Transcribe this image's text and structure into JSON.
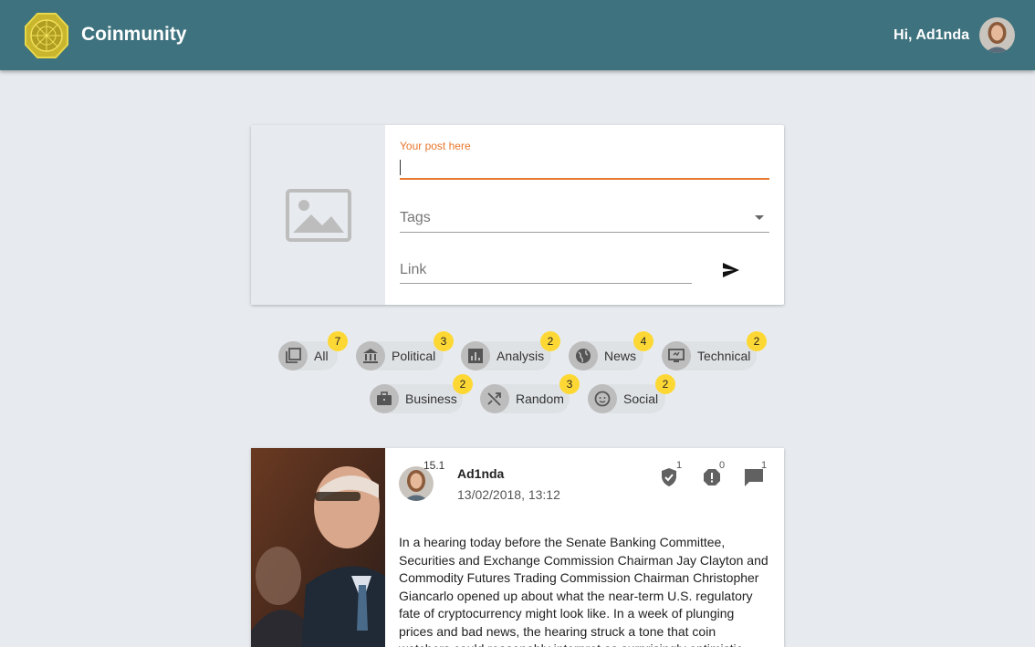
{
  "app": {
    "name": "Coinmunity",
    "logo_icon": "coin-logo-icon",
    "accent": "#3e727e"
  },
  "header": {
    "greeting": "Hi, Ad1nda",
    "avatar_icon": "user-avatar"
  },
  "composer": {
    "post_label": "Your post here",
    "post_value": "",
    "tags_label": "Tags",
    "link_placeholder": "Link",
    "image_icon": "image-placeholder-icon",
    "send_icon": "send-icon",
    "focus_color": "#e8762c"
  },
  "filters": [
    {
      "label": "All",
      "count": "7",
      "icon": "collection-icon"
    },
    {
      "label": "Political",
      "count": "3",
      "icon": "bank-icon"
    },
    {
      "label": "Analysis",
      "count": "2",
      "icon": "bar-chart-icon"
    },
    {
      "label": "News",
      "count": "4",
      "icon": "globe-icon"
    },
    {
      "label": "Technical",
      "count": "2",
      "icon": "monitor-icon"
    },
    {
      "label": "Business",
      "count": "2",
      "icon": "briefcase-icon"
    },
    {
      "label": "Random",
      "count": "3",
      "icon": "shuffle-icon"
    },
    {
      "label": "Social",
      "count": "2",
      "icon": "smiley-icon"
    }
  ],
  "badge_color": "#fdd835",
  "post": {
    "author": "Ad1nda",
    "score": "15.1",
    "date": "13/02/2018, 13:12",
    "verify_count": "1",
    "report_count": "0",
    "comment_count": "1",
    "body": "In a hearing today before the Senate Banking Committee, Securities and Exchange Commission Chairman Jay Clayton and Commodity Futures Trading Commission Chairman Christopher Giancarlo opened up about what the near-term U.S. regulatory fate of cryptocurrency might look like. In a week of plunging prices and bad news, the hearing struck a tone that coin watchers could reasonably interpret as surprisingly optimistic. Over the course of"
  }
}
